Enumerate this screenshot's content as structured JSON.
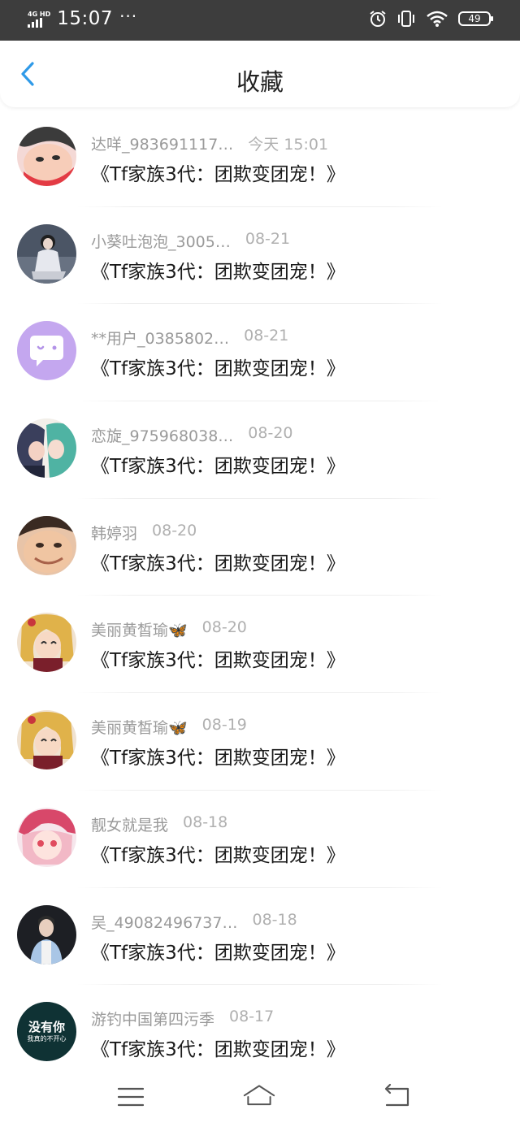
{
  "status_bar": {
    "network": "4G HD",
    "time": "15:07",
    "dots": "···",
    "battery": "49"
  },
  "header": {
    "title": "收藏"
  },
  "items": [
    {
      "name": "达咩_983691117…",
      "time": "今天 15:01",
      "message": "《Tf家族3代：团欺变团宠！》",
      "avatar": "cartoon-boy-avatar"
    },
    {
      "name": "小葵吐泡泡_3005…",
      "time": "08-21",
      "message": "《Tf家族3代：团欺变团宠！》",
      "avatar": "girl-photo-avatar"
    },
    {
      "name": "**用户_0385802…",
      "time": "08-21",
      "message": "《Tf家族3代：团欺变团宠！》",
      "avatar": "default-chat-avatar"
    },
    {
      "name": "恋旋_975968038…",
      "time": "08-20",
      "message": "《Tf家族3代：团欺变团宠！》",
      "avatar": "anime-couple-avatar"
    },
    {
      "name": "韩婷羽",
      "time": "08-20",
      "message": "《Tf家族3代：团欺变团宠！》",
      "avatar": "funny-face-avatar"
    },
    {
      "name": "美丽黄皙瑜🦋",
      "time": "08-20",
      "message": "《Tf家族3代：团欺变团宠！》",
      "avatar": "sailor-moon-avatar"
    },
    {
      "name": "美丽黄皙瑜🦋",
      "time": "08-19",
      "message": "《Tf家族3代：团欺变团宠！》",
      "avatar": "sailor-moon-avatar"
    },
    {
      "name": "靓女就是我",
      "time": "08-18",
      "message": "《Tf家族3代：团欺变团宠！》",
      "avatar": "anime-girl-pink-avatar"
    },
    {
      "name": "吴_49082496737…",
      "time": "08-18",
      "message": "《Tf家族3代：团欺变团宠！》",
      "avatar": "boy-photo-avatar"
    },
    {
      "name": "游钓中国第四污季",
      "time": "08-17",
      "message": "《Tf家族3代：团欺变团宠！》",
      "avatar": "text-avatar",
      "avatar_text_1": "没有你",
      "avatar_text_2": "我真的不开心"
    }
  ],
  "colors": {
    "accent": "#2f9ae8",
    "status_bar": "#3d3d3d",
    "name_text": "#9a9a9a",
    "message_text": "#1a1a1a"
  }
}
